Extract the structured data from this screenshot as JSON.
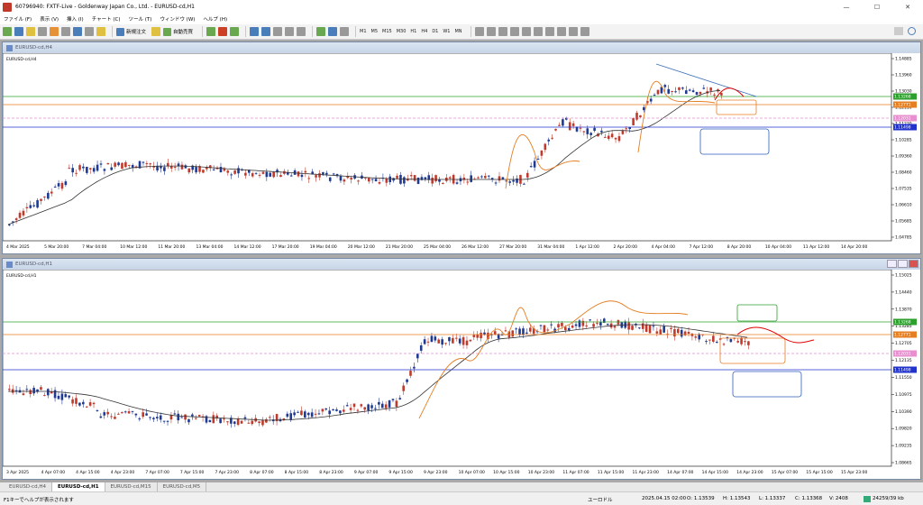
{
  "window": {
    "title": "60796940: FXTF-Live - Goldenway Japan Co., Ltd. - EURUSD-cd,H1",
    "min": "—",
    "max": "☐",
    "close": "✕"
  },
  "menu": [
    "ファイル (F)",
    "表示 (V)",
    "挿入 (I)",
    "チャート (C)",
    "ツール (T)",
    "ウィンドウ (W)",
    "ヘルプ (H)"
  ],
  "toolbar": {
    "new_order": "新規注文",
    "auto_trade": "自動売買",
    "timeframes": [
      "M1",
      "M5",
      "M15",
      "M30",
      "H1",
      "H4",
      "D1",
      "W1",
      "MN"
    ]
  },
  "chart1": {
    "window_title": "EURUSD-cd,H4",
    "label": "EURUSD-cd,H4",
    "price_ticks": [
      "1.14885",
      "1.13960",
      "1.13030",
      "1.12110",
      "1.11230",
      "1.10285",
      "1.09360",
      "1.08460",
      "1.07535",
      "1.06610",
      "1.05685",
      "1.04785"
    ],
    "price_tags": [
      "1.13268",
      "1.12771",
      "1.12031",
      "1.11498"
    ],
    "time_ticks": [
      "4 Mar 2025",
      "5 Mar 20:00",
      "7 Mar 04:00",
      "10 Mar 12:00",
      "11 Mar 20:00",
      "13 Mar 04:00",
      "14 Mar 12:00",
      "17 Mar 20:00",
      "19 Mar 04:00",
      "20 Mar 12:00",
      "21 Mar 20:00",
      "25 Mar 04:00",
      "26 Mar 12:00",
      "27 Mar 20:00",
      "31 Mar 04:00",
      "1 Apr 12:00",
      "2 Apr 20:00",
      "4 Apr 04:00",
      "7 Apr 12:00",
      "8 Apr 20:00",
      "10 Apr 04:00",
      "11 Apr 12:00",
      "14 Apr 20:00"
    ]
  },
  "chart2": {
    "window_title": "EURUSD-cd,H1",
    "label": "EURUSD-cd,H1",
    "price_ticks": [
      "1.15025",
      "1.14440",
      "1.13870",
      "1.13285",
      "1.12705",
      "1.12135",
      "1.11550",
      "1.10975",
      "1.10390",
      "1.09820",
      "1.09235",
      "1.08665"
    ],
    "price_tags": [
      "1.13268",
      "1.12771",
      "1.12031",
      "1.11498"
    ],
    "time_ticks": [
      "3 Apr 2025",
      "4 Apr 07:00",
      "4 Apr 15:00",
      "4 Apr 23:00",
      "7 Apr 07:00",
      "7 Apr 15:00",
      "7 Apr 23:00",
      "8 Apr 07:00",
      "8 Apr 15:00",
      "8 Apr 23:00",
      "9 Apr 07:00",
      "9 Apr 15:00",
      "9 Apr 23:00",
      "10 Apr 07:00",
      "10 Apr 15:00",
      "10 Apr 23:00",
      "11 Apr 07:00",
      "11 Apr 15:00",
      "11 Apr 23:00",
      "14 Apr 07:00",
      "14 Apr 15:00",
      "14 Apr 23:00",
      "15 Apr 07:00",
      "15 Apr 15:00",
      "15 Apr 23:00"
    ]
  },
  "tabs": [
    "EURUSD-cd,H4",
    "EURUSD-cd,H1",
    "EURUSD-cd,M15",
    "EURUSD-cd,M5"
  ],
  "status": {
    "help": "F1キーでヘルプが表示されます",
    "profile": "ユーロドル",
    "datetime": "2025.04.15 02:00",
    "open": "O: 1.13539",
    "high": "H: 1.13543",
    "low": "L: 1.13337",
    "close": "C: 1.13368",
    "volume": "V: 2408",
    "traffic": "24259/39 kb"
  },
  "colors": {
    "bull": "#c0392b",
    "bear": "#1f3a93",
    "ma": "#333333",
    "orange": "#e67e22",
    "green": "#2ca02c",
    "blue": "#2233cc",
    "pink": "#e88fd0",
    "red": "#e00000"
  }
}
